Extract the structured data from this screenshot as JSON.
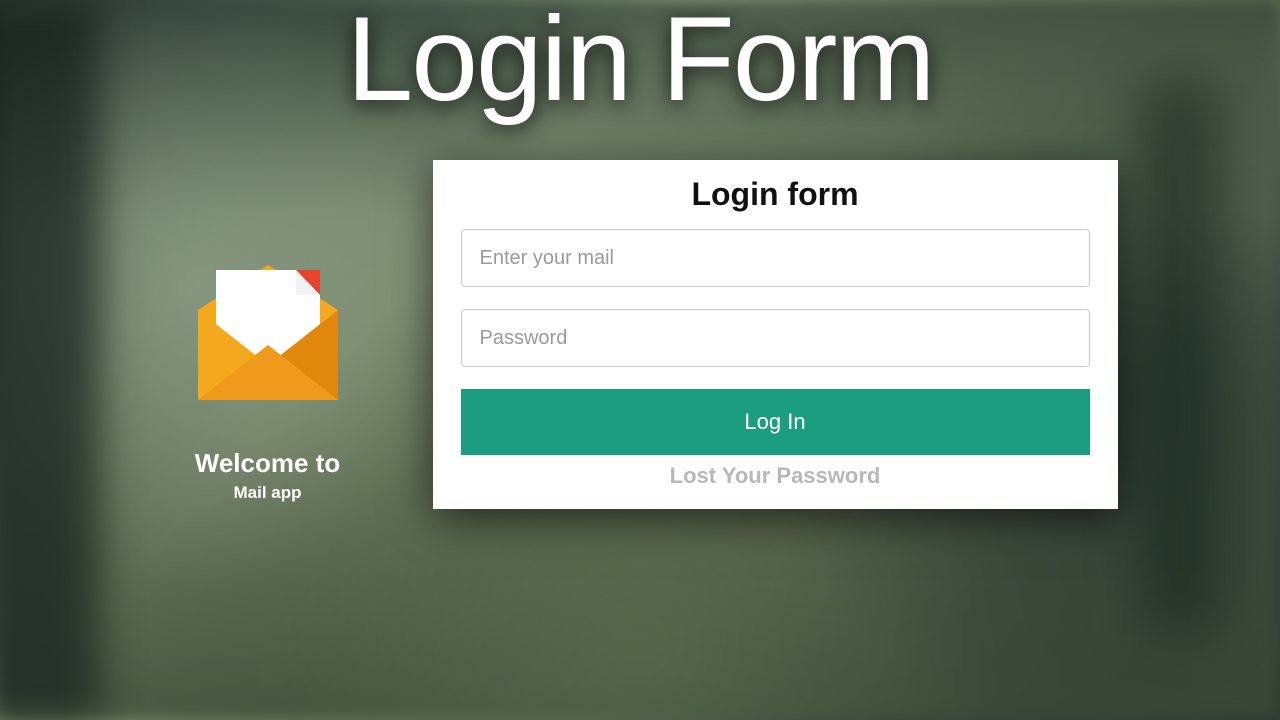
{
  "page": {
    "title": "Login Form"
  },
  "sidebar": {
    "welcome_title": "Welcome to",
    "welcome_subtitle": "Mail app",
    "icon_name": "mail-envelope-icon"
  },
  "form": {
    "title": "Login form",
    "email_placeholder": "Enter your mail",
    "password_placeholder": "Password",
    "submit_label": "Log In",
    "lost_password_label": "Lost Your Password"
  },
  "colors": {
    "accent": "#1a9e7f",
    "card_bg": "#ffffff"
  }
}
